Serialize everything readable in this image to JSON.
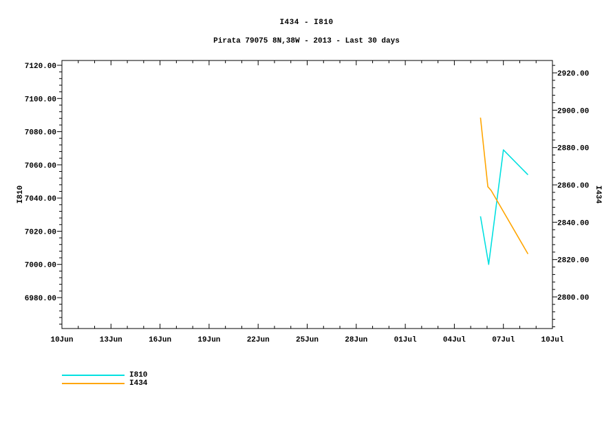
{
  "page": {
    "background": "#ffffff"
  },
  "chart_data": {
    "type": "line",
    "title": "I434 - I810",
    "subtitle": "Pirata 79075 8N,38W - 2013 - Last 30 days",
    "x_axis": {
      "tick_labels": [
        "10Jun",
        "13Jun",
        "16Jun",
        "19Jun",
        "22Jun",
        "25Jun",
        "28Jun",
        "01Jul",
        "04Jul",
        "07Jul",
        "10Jul"
      ],
      "tick_days": [
        0,
        3,
        6,
        9,
        12,
        15,
        18,
        21,
        24,
        27,
        30
      ],
      "range_days": [
        0,
        30
      ],
      "minor_step_days": 1
    },
    "y_left": {
      "label": "I810",
      "tick_labels": [
        "7120.00",
        "7100.00",
        "7080.00",
        "7060.00",
        "7040.00",
        "7020.00",
        "7000.00",
        "6980.00"
      ],
      "tick_values": [
        7120,
        7100,
        7080,
        7060,
        7040,
        7020,
        7000,
        6980
      ],
      "minor_step": 4,
      "minor_tick_range": [
        6964,
        7120
      ],
      "ylim": [
        6961,
        7123
      ]
    },
    "y_right": {
      "label": "I434",
      "tick_labels": [
        "2920.00",
        "2900.00",
        "2880.00",
        "2860.00",
        "2840.00",
        "2820.00",
        "2800.00"
      ],
      "tick_values": [
        2920,
        2900,
        2880,
        2860,
        2840,
        2820,
        2800
      ],
      "minor_step": 4,
      "minor_tick_range": [
        2784,
        2924
      ],
      "ylim": [
        2783,
        2927
      ]
    },
    "series": [
      {
        "name": "I810",
        "color": "#00e0e0",
        "axis": "left",
        "points_days": [
          25.6,
          26.1,
          27.0,
          28.5
        ],
        "points_values": [
          7029,
          7000,
          7069,
          7054
        ]
      },
      {
        "name": "I434",
        "color": "#ffa500",
        "axis": "right",
        "points_days": [
          25.6,
          26.05,
          26.25,
          28.5
        ],
        "points_values": [
          2896,
          2859,
          2857,
          2823
        ]
      }
    ],
    "legend": {
      "entries": [
        "I810",
        "I434"
      ]
    },
    "grid": false,
    "legend_position": "bottom-left"
  }
}
